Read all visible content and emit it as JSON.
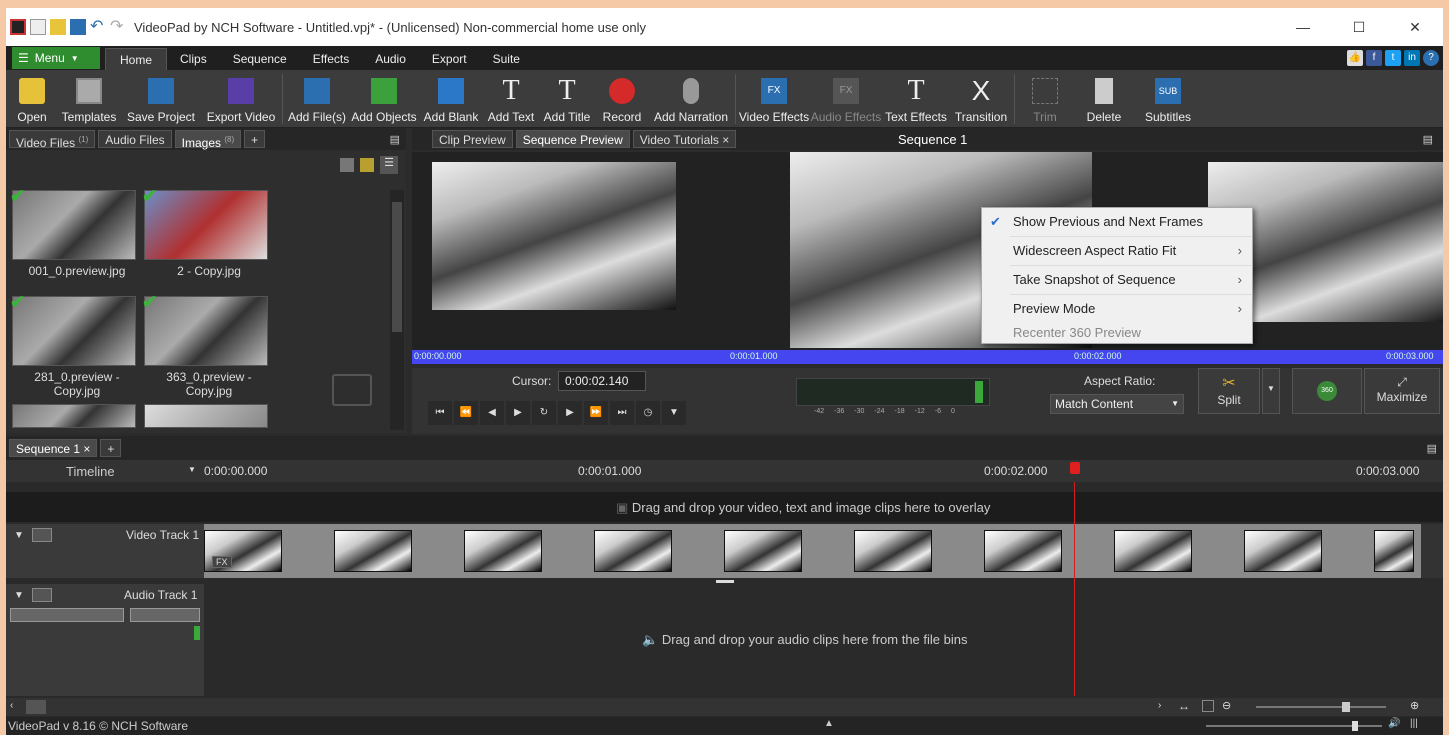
{
  "window": {
    "title": "VideoPad by NCH Software - Untitled.vpj* - (Unlicensed) Non-commercial home use only"
  },
  "menubar": {
    "menu_label": "Menu",
    "tabs": [
      "Home",
      "Clips",
      "Sequence",
      "Effects",
      "Audio",
      "Export",
      "Suite"
    ]
  },
  "toolbar": {
    "buttons": [
      "Open",
      "Templates",
      "Save Project",
      "Export Video",
      "Add File(s)",
      "Add Objects",
      "Add Blank",
      "Add Text",
      "Add Title",
      "Record",
      "Add Narration",
      "Video Effects",
      "Audio Effects",
      "Text Effects",
      "Transition",
      "Trim",
      "Delete",
      "Subtitles"
    ]
  },
  "bins": {
    "tabs": [
      {
        "label": "Video Files",
        "count": "(1)"
      },
      {
        "label": "Audio Files",
        "count": ""
      },
      {
        "label": "Images",
        "count": "(8)"
      },
      {
        "label": "+",
        "count": ""
      }
    ],
    "items": [
      "001_0.preview.jpg",
      "2 - Copy.jpg",
      "281_0.preview - Copy.jpg",
      "363_0.preview - Copy.jpg"
    ]
  },
  "preview": {
    "tabs": [
      "Clip Preview",
      "Sequence Preview",
      "Video Tutorials"
    ],
    "sequence_title": "Sequence 1",
    "bar_times": [
      "0:00:00.000",
      "0:00:01.000",
      "0:00:02.000",
      "0:00:03.000"
    ],
    "cursor_label": "Cursor:",
    "cursor_value": "0:00:02.140",
    "meter_ticks": [
      "-42",
      "-36",
      "-30",
      "-24",
      "-18",
      "-12",
      "-6",
      "0"
    ],
    "aspect_label": "Aspect Ratio:",
    "aspect_value": "Match Content",
    "split_label": "Split",
    "maximize_label": "Maximize",
    "vr_label": "360"
  },
  "context_menu": {
    "items": [
      {
        "label": "Show Previous and Next Frames",
        "checked": true,
        "submenu": false,
        "disabled": false
      },
      {
        "label": "Widescreen Aspect Ratio Fit",
        "checked": false,
        "submenu": true,
        "disabled": false
      },
      {
        "label": "Take Snapshot of Sequence",
        "checked": false,
        "submenu": true,
        "disabled": false
      },
      {
        "label": "Preview Mode",
        "checked": false,
        "submenu": true,
        "disabled": false
      },
      {
        "label": "Recenter 360 Preview",
        "checked": false,
        "submenu": false,
        "disabled": true
      }
    ]
  },
  "sequence": {
    "tab_label": "Sequence 1",
    "timeline_label": "Timeline",
    "ruler_times": [
      "0:00:00.000",
      "0:00:01.000",
      "0:00:02.000",
      "0:00:03.000"
    ],
    "overlay_hint": "Drag and drop your video, text and image clips here to overlay",
    "video_track": "Video Track 1",
    "audio_track": "Audio Track 1",
    "audio_hint": "Drag and drop your audio clips here from the file bins",
    "fx_label": "FX"
  },
  "status": {
    "version": "VideoPad v 8.16 © NCH Software"
  }
}
